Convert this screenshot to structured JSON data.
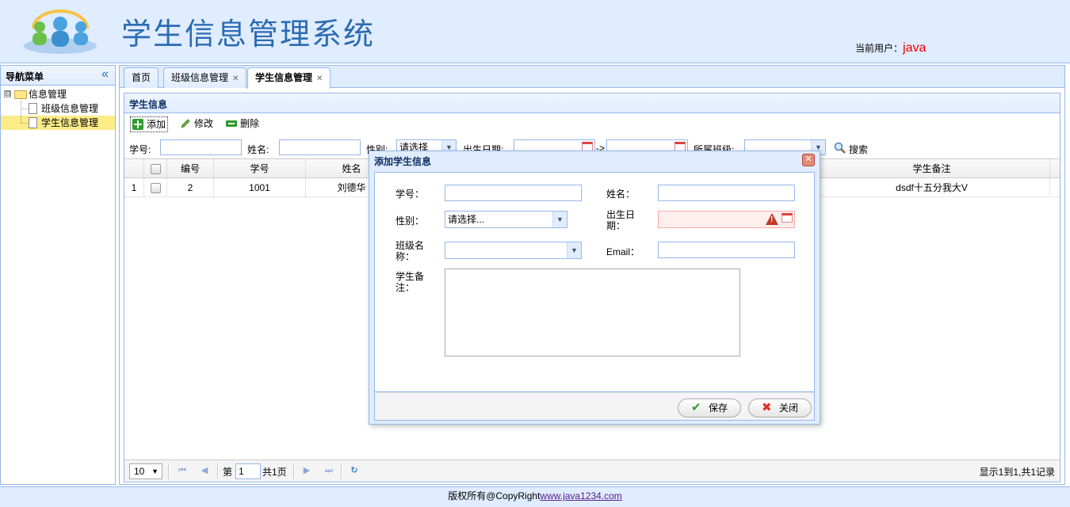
{
  "header": {
    "title": "学生信息管理系统",
    "current_user_label": "当前用户：",
    "current_user": "java"
  },
  "nav": {
    "title": "导航菜单",
    "collapse_icon": "double-chevron-left-icon",
    "root": {
      "label": "信息管理",
      "toggle": "⊟"
    },
    "items": [
      {
        "label": "班级信息管理",
        "selected": false
      },
      {
        "label": "学生信息管理",
        "selected": true
      }
    ]
  },
  "tabs": [
    {
      "label": "首页"
    },
    {
      "label": "班级信息管理",
      "closable": true
    },
    {
      "label": "学生信息管理",
      "closable": true,
      "active": true
    }
  ],
  "panel": {
    "title": "学生信息",
    "toolbar": {
      "add": "添加",
      "edit": "修改",
      "delete": "删除"
    },
    "search": {
      "stu_no_label": "学号:",
      "name_label": "姓名:",
      "sex_label": "性别:",
      "sex_value": "请选择",
      "birth_label": "出生日期:",
      "range_sep": "->",
      "class_label": "所属班级:",
      "search_button": "搜索"
    },
    "grid": {
      "columns": {
        "id": "编号",
        "stu_no": "学号",
        "name": "姓名",
        "remark": "学生备注"
      },
      "rows": [
        {
          "rownum": "1",
          "id": "2",
          "stu_no": "1001",
          "name": "刘德华",
          "remark": "dsdf十五分我大V"
        }
      ]
    },
    "pager": {
      "page_size": "10",
      "page_prefix": "第",
      "page": "1",
      "page_total": "共1页",
      "summary": "显示1到1,共1记录"
    }
  },
  "dialog": {
    "title": "添加学生信息",
    "fields": {
      "stu_no": "学号：",
      "name": "姓名：",
      "sex": "性别：",
      "sex_value": "请选择...",
      "birth_line1": "出生日",
      "birth_line2": "期：",
      "class_line1": "班级名",
      "class_line2": "称：",
      "email": "Email：",
      "remark_line1": "学生备",
      "remark_line2": "注："
    },
    "buttons": {
      "save": "保存",
      "close": "关闭"
    }
  },
  "footer": {
    "text": "版权所有@CopyRight",
    "link": "www.java1234.com"
  },
  "colors": {
    "accent": "#95b8e7",
    "panel_bg": "#e0ecff",
    "title": "#2b6cb3",
    "user": "#ee0000",
    "selected_row": "#fbec88"
  }
}
